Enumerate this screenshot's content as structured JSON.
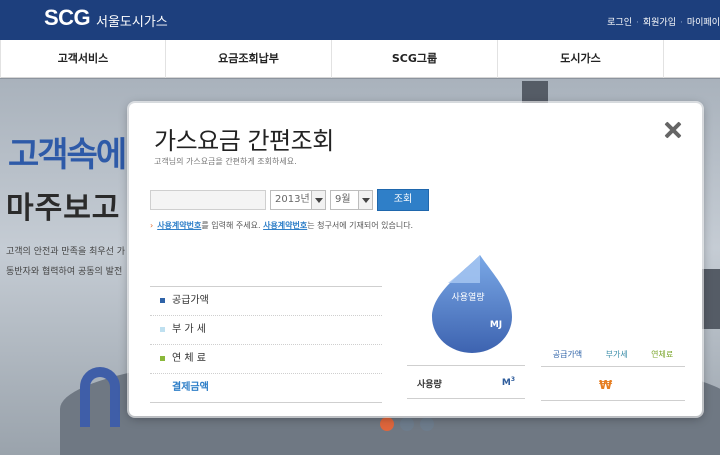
{
  "header": {
    "brand": "SCG",
    "brand_sub": "서울도시가스",
    "links": [
      "로그인",
      "회원가입",
      "마이페이"
    ]
  },
  "nav": {
    "items": [
      "고객서비스",
      "요금조회납부",
      "SCG그룹",
      "도시가스"
    ]
  },
  "hero": {
    "slogan_line1": "고객속에",
    "slogan_line2": "마주보고",
    "text_line1": "고객의 안전과 만족을 최우선 가",
    "text_line2": "동반자와 협력하여 공동의 발전"
  },
  "modal": {
    "title": "가스요금 간편조회",
    "subtitle": "고객님의 가스요금을 간편하게 조회하세요.",
    "contract_placeholder": "",
    "year_value": "2013년",
    "month_value": "9월",
    "query_button": "조회",
    "notice_part1": "사용계약번호",
    "notice_part2": "를 입력해 주세요.",
    "notice_part3": "사용계약번호",
    "notice_part4": "는 청구서에 기재되어 있습니다.",
    "fees": [
      {
        "label": "공급가액",
        "bullet_color": "#2f63a8"
      },
      {
        "label": "부 가 세",
        "bullet_color": "#bfe0f0"
      },
      {
        "label": "연 체 료",
        "bullet_color": "#8ab83a"
      }
    ],
    "total_label": "결제금액",
    "drop_label": "사용열량",
    "drop_unit": "MJ",
    "usage_label": "사용량",
    "usage_unit": "M",
    "usage_unit_sup": "3",
    "legend": [
      "공급가액",
      "부가세",
      "연체료"
    ],
    "currency_symbol": "₩"
  }
}
